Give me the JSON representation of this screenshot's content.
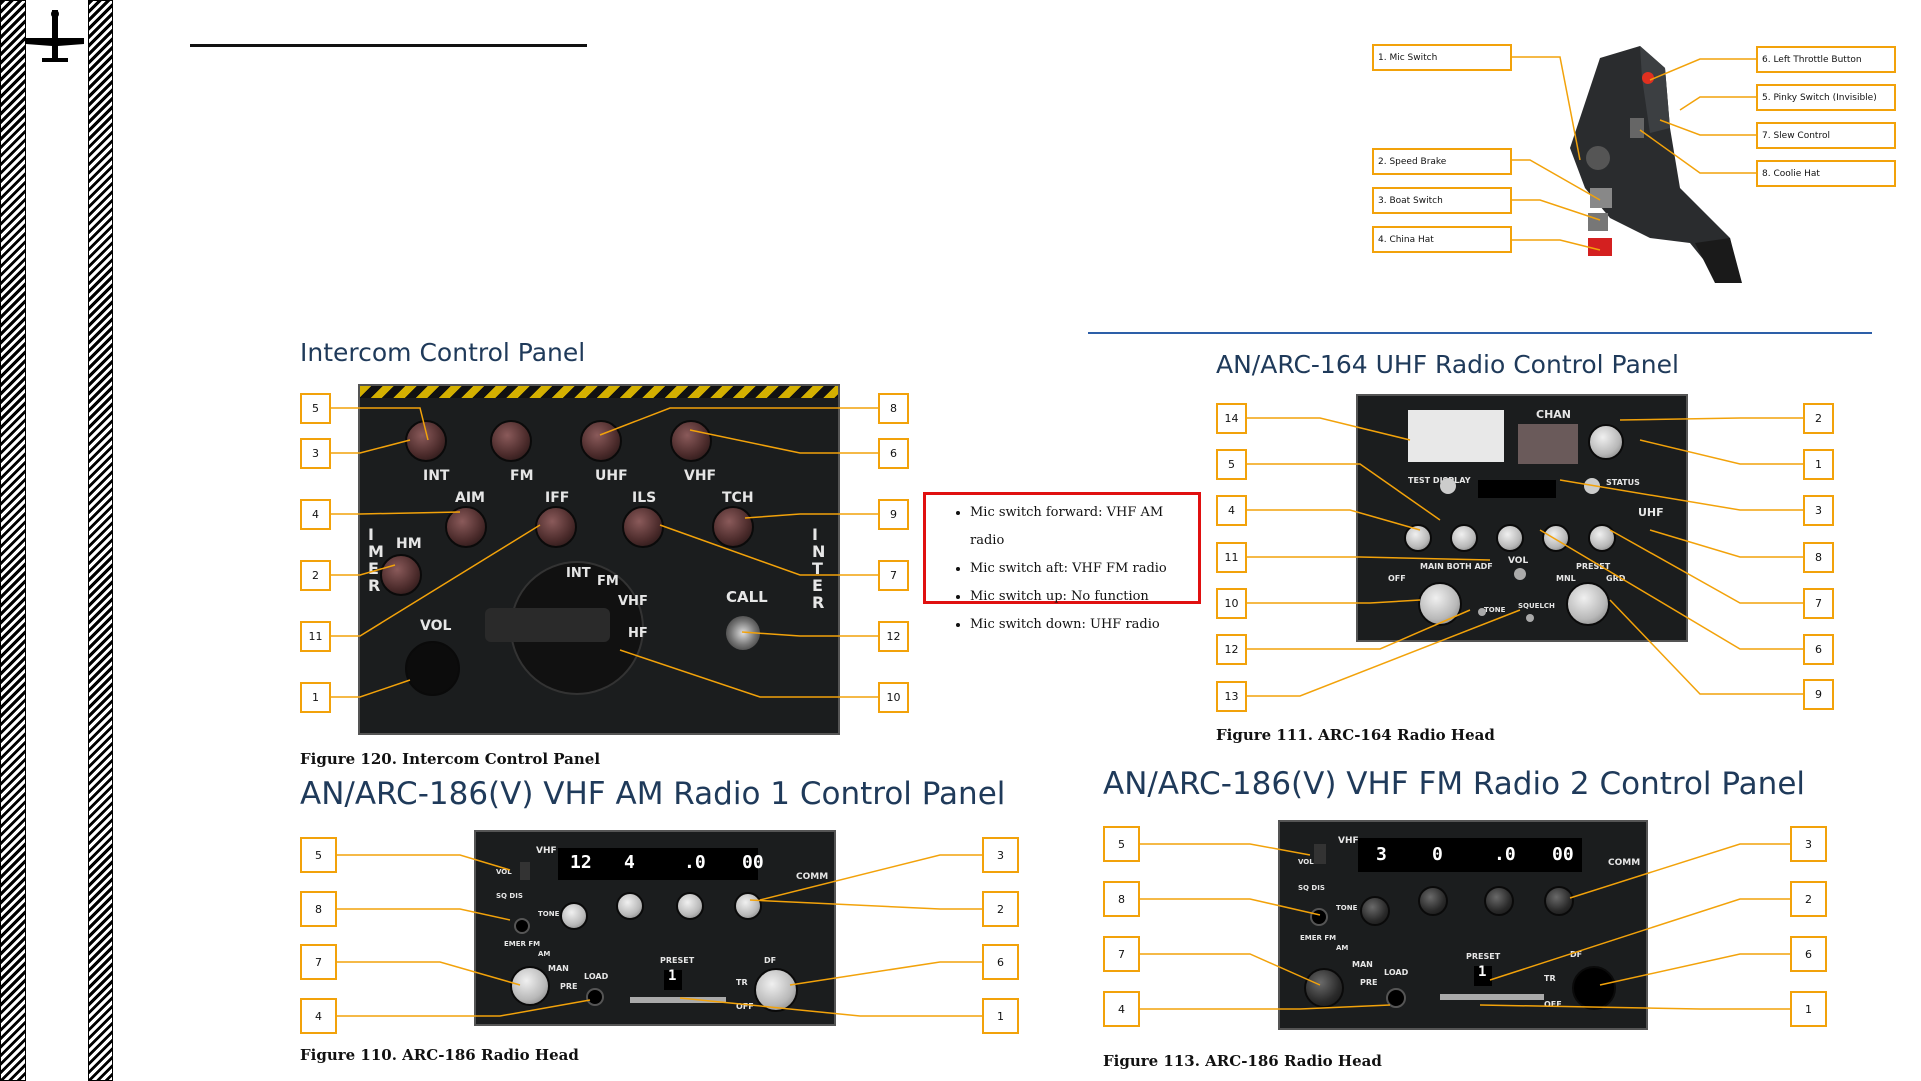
{
  "intercom": {
    "title": "Intercom Control Panel",
    "caption": "Figure 120. Intercom Control Panel",
    "left_callouts": [
      "5",
      "3",
      "4",
      "2",
      "11",
      "1"
    ],
    "right_callouts": [
      "8",
      "6",
      "9",
      "7",
      "12",
      "10"
    ],
    "knob_labels": [
      "INT",
      "FM",
      "UHF",
      "VHF",
      "AIM",
      "IFF",
      "ILS",
      "TCH",
      "HM"
    ],
    "vol_label": "VOL",
    "call_label": "CALL",
    "selector_labels": [
      "INT",
      "FM",
      "VHF",
      "HF"
    ],
    "side_left": [
      "I",
      "M",
      "E",
      "R"
    ],
    "side_right": [
      "I",
      "N",
      "T",
      "E",
      "R"
    ]
  },
  "mic_notes": {
    "items": [
      "Mic switch forward: VHF AM radio",
      "Mic switch aft: VHF FM radio",
      "Mic switch up: No function",
      "Mic switch down: UHF radio"
    ]
  },
  "throttle": {
    "left_labels": [
      "1. Mic Switch",
      "2. Speed Brake",
      "3. Boat Switch",
      "4. China Hat"
    ],
    "right_labels": [
      "6. Left Throttle Button",
      "5. Pinky Switch (Invisible)",
      "7. Slew Control",
      "8. Coolie Hat"
    ]
  },
  "uhf": {
    "title": "AN/ARC-164 UHF Radio Control Panel",
    "caption": "Figure 111. ARC-164 Radio Head",
    "left_callouts": [
      "14",
      "5",
      "4",
      "11",
      "10",
      "12",
      "13"
    ],
    "right_callouts": [
      "2",
      "1",
      "3",
      "8",
      "7",
      "6",
      "9"
    ],
    "texts": [
      "CHAN",
      "TEST DISPLAY",
      "STATUS",
      "VOL",
      "MAIN BOTH ADF",
      "OFF",
      "PRESET",
      "MNL",
      "GRD",
      "TONE",
      "SQUELCH",
      "UHF"
    ]
  },
  "vhf_am": {
    "title": "AN/ARC-186(V) VHF AM Radio 1 Control Panel",
    "caption": "Figure 110. ARC-186 Radio Head",
    "left_callouts": [
      "5",
      "8",
      "7",
      "4"
    ],
    "right_callouts": [
      "3",
      "2",
      "6",
      "1"
    ],
    "digits": [
      "12",
      "4",
      ".0",
      "00"
    ],
    "preset": "1",
    "texts": [
      "VHF",
      "COMM",
      "PRESET",
      "LOAD",
      "PRE",
      "MAN",
      "EMER FM",
      "AM",
      "TR",
      "DF",
      "OFF",
      "VOL",
      "SQ DIS",
      "TONE"
    ]
  },
  "vhf_fm": {
    "title": "AN/ARC-186(V) VHF FM Radio 2 Control Panel",
    "caption": "Figure 113. ARC-186 Radio Head",
    "left_callouts": [
      "5",
      "8",
      "7",
      "4"
    ],
    "right_callouts": [
      "3",
      "2",
      "6",
      "1"
    ],
    "digits": [
      "3",
      "0",
      ".0",
      "00"
    ],
    "preset": "1",
    "texts": [
      "VHF",
      "COMM",
      "PRESET",
      "LOAD",
      "PRE",
      "MAN",
      "EMER FM",
      "AM",
      "TR",
      "DF",
      "OFF",
      "VOL",
      "SQ DIS",
      "TONE"
    ]
  },
  "colors": {
    "callout": "#f2a20a",
    "title": "#1f3a5a",
    "note_border": "#e01010",
    "rule": "#2d5fa8"
  },
  "icons": [
    "aircraft-icon"
  ]
}
